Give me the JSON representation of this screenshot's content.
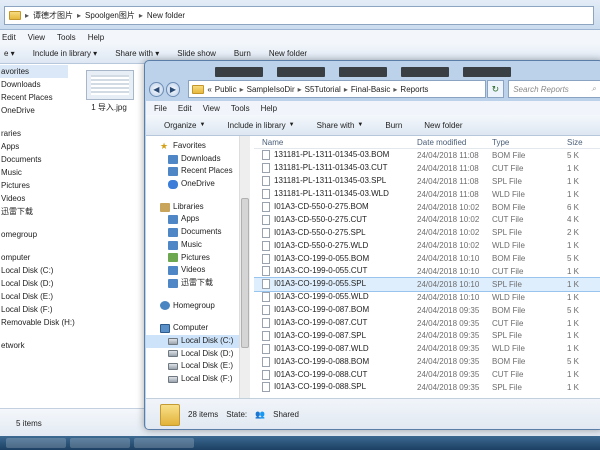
{
  "back_window": {
    "breadcrumb": [
      "谭德才图片",
      "Spoolgen图片",
      "New folder"
    ],
    "menu": [
      "Edit",
      "View",
      "Tools",
      "Help"
    ],
    "toolbar": [
      "e ▾",
      "Include in library ▾",
      "Share with ▾",
      "Slide show",
      "Burn",
      "New folder"
    ],
    "nav": [
      "avorites",
      "Downloads",
      "Recent Places",
      "OneDrive",
      "",
      "raries",
      "Apps",
      "Documents",
      "Music",
      "Pictures",
      "Videos",
      "迅雷下载",
      "",
      "omegroup",
      "",
      "omputer",
      "Local Disk (C:)",
      "Local Disk (D:)",
      "Local Disk (E:)",
      "Local Disk (F:)",
      "Removable Disk (H:)",
      "",
      "etwork"
    ],
    "thumb_caption": "1 导入.jpg",
    "status": "5 items"
  },
  "front_window": {
    "breadcrumb": [
      "«",
      "Public",
      "SampleIsoDir",
      "S5Tutorial",
      "Final-Basic",
      "Reports"
    ],
    "search_placeholder": "Search Reports",
    "menu": [
      "File",
      "Edit",
      "View",
      "Tools",
      "Help"
    ],
    "cmd": {
      "organize": "Organize",
      "include": "Include in library",
      "share": "Share with",
      "burn": "Burn",
      "newfolder": "New folder"
    },
    "tree": {
      "favorites": "Favorites",
      "downloads": "Downloads",
      "recent": "Recent Places",
      "onedrive": "OneDrive",
      "libraries": "Libraries",
      "apps": "Apps",
      "documents": "Documents",
      "music": "Music",
      "pictures": "Pictures",
      "videos": "Videos",
      "xunlei": "迅雷下载",
      "homegroup": "Homegroup",
      "computer": "Computer",
      "c": "Local Disk (C:)",
      "d": "Local Disk (D:)",
      "e": "Local Disk (E:)",
      "f": "Local Disk (F:)"
    },
    "columns": {
      "name": "Name",
      "date": "Date modified",
      "type": "Type",
      "size": "Size"
    },
    "files": [
      {
        "name": "131181-PL-1311-01345-03.BOM",
        "date": "24/04/2018 11:08",
        "type": "BOM File",
        "size": "5 K"
      },
      {
        "name": "131181-PL-1311-01345-03.CUT",
        "date": "24/04/2018 11:08",
        "type": "CUT File",
        "size": "1 K"
      },
      {
        "name": "131181-PL-1311-01345-03.SPL",
        "date": "24/04/2018 11:08",
        "type": "SPL File",
        "size": "1 K"
      },
      {
        "name": "131181-PL-1311-01345-03.WLD",
        "date": "24/04/2018 11:08",
        "type": "WLD File",
        "size": "1 K"
      },
      {
        "name": "I01A3-CD-550-0-275.BOM",
        "date": "24/04/2018 10:02",
        "type": "BOM File",
        "size": "6 K"
      },
      {
        "name": "I01A3-CD-550-0-275.CUT",
        "date": "24/04/2018 10:02",
        "type": "CUT File",
        "size": "4 K"
      },
      {
        "name": "I01A3-CD-550-0-275.SPL",
        "date": "24/04/2018 10:02",
        "type": "SPL File",
        "size": "2 K"
      },
      {
        "name": "I01A3-CD-550-0-275.WLD",
        "date": "24/04/2018 10:02",
        "type": "WLD File",
        "size": "1 K"
      },
      {
        "name": "I01A3-CO-199-0-055.BOM",
        "date": "24/04/2018 10:10",
        "type": "BOM File",
        "size": "5 K"
      },
      {
        "name": "I01A3-CO-199-0-055.CUT",
        "date": "24/04/2018 10:10",
        "type": "CUT File",
        "size": "1 K"
      },
      {
        "name": "I01A3-CO-199-0-055.SPL",
        "date": "24/04/2018 10:10",
        "type": "SPL File",
        "size": "1 K"
      },
      {
        "name": "I01A3-CO-199-0-055.WLD",
        "date": "24/04/2018 10:10",
        "type": "WLD File",
        "size": "1 K"
      },
      {
        "name": "I01A3-CO-199-0-087.BOM",
        "date": "24/04/2018 09:35",
        "type": "BOM File",
        "size": "5 K"
      },
      {
        "name": "I01A3-CO-199-0-087.CUT",
        "date": "24/04/2018 09:35",
        "type": "CUT File",
        "size": "1 K"
      },
      {
        "name": "I01A3-CO-199-0-087.SPL",
        "date": "24/04/2018 09:35",
        "type": "SPL File",
        "size": "1 K"
      },
      {
        "name": "I01A3-CO-199-0-087.WLD",
        "date": "24/04/2018 09:35",
        "type": "WLD File",
        "size": "1 K"
      },
      {
        "name": "I01A3-CO-199-0-088.BOM",
        "date": "24/04/2018 09:35",
        "type": "BOM File",
        "size": "5 K"
      },
      {
        "name": "I01A3-CO-199-0-088.CUT",
        "date": "24/04/2018 09:35",
        "type": "CUT File",
        "size": "1 K"
      },
      {
        "name": "I01A3-CO-199-0-088.SPL",
        "date": "24/04/2018 09:35",
        "type": "SPL File",
        "size": "1 K"
      }
    ],
    "selected_index": 10,
    "status_count": "28 items",
    "status_state_label": "State:",
    "status_state_value": "Shared"
  },
  "colors": {
    "accent": "#3b6fa8",
    "selection": "#dfeefc"
  }
}
